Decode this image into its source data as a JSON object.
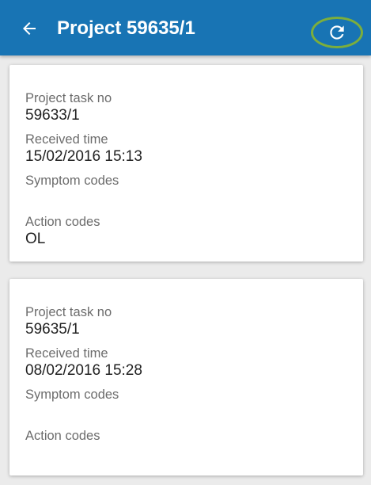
{
  "header": {
    "title": "Project 59635/1",
    "back_icon": "arrow-left-icon",
    "refresh_icon": "refresh-icon",
    "background_color": "#1874b4",
    "highlight_color": "#7cae3c"
  },
  "cards": [
    {
      "project_task_label": "Project task no",
      "project_task_value": "59633/1",
      "received_time_label": "Received time",
      "received_time_value": "15/02/2016 15:13",
      "symptom_codes_label": "Symptom codes",
      "symptom_codes_value": "",
      "action_codes_label": "Action codes",
      "action_codes_value": "OL"
    },
    {
      "project_task_label": "Project task no",
      "project_task_value": "59635/1",
      "received_time_label": "Received time",
      "received_time_value": "08/02/2016 15:28",
      "symptom_codes_label": "Symptom codes",
      "symptom_codes_value": "",
      "action_codes_label": "Action codes",
      "action_codes_value": ""
    }
  ]
}
